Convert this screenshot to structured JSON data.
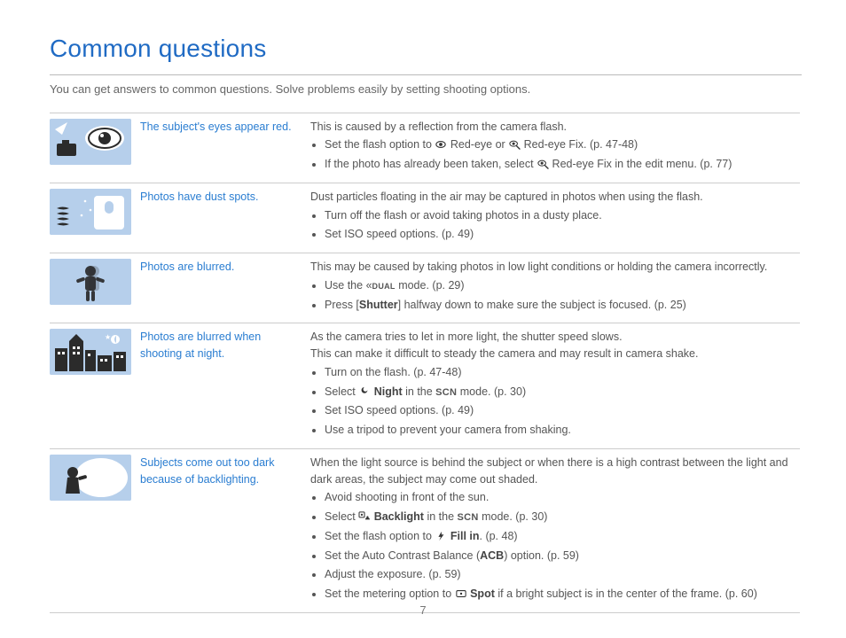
{
  "title": "Common questions",
  "intro": "You can get answers to common questions. Solve problems easily by setting shooting options.",
  "pageNumber": "7",
  "rows": [
    {
      "question": "The subject's eyes appear red.",
      "lead": "This is caused by a reflection from the camera flash.",
      "bullets": [
        {
          "pre": "Set the flash option to ",
          "icon": "eye-icon",
          "mid": " Red-eye or ",
          "icon2": "eye-brush-icon",
          "post": " Red-eye Fix. (p. 47-48)"
        },
        {
          "pre": "If the photo has already been taken, select ",
          "icon": "eye-brush-icon",
          "post": " Red-eye Fix in the edit menu. (p. 77)"
        }
      ]
    },
    {
      "question": "Photos have dust spots.",
      "lead": "Dust particles floating in the air may be captured in photos when using the flash.",
      "bullets": [
        {
          "text": "Turn off the flash or avoid taking photos in a dusty place."
        },
        {
          "text": "Set ISO speed options. (p. 49)"
        }
      ]
    },
    {
      "question": "Photos are blurred.",
      "lead": "This may be caused by taking photos in low light conditions or holding the camera incorrectly.",
      "bullets": [
        {
          "pre": "Use the ",
          "dual": true,
          "post": " mode. (p. 29)"
        },
        {
          "pre": "Press [",
          "bold": "Shutter",
          "post": "] halfway down to make sure the subject is focused. (p. 25)"
        }
      ]
    },
    {
      "question": "Photos are blurred when shooting at night.",
      "lead": "As the camera tries to let in more light, the shutter speed slows.",
      "lead2": "This can make it difficult to steady the camera and may result in camera shake.",
      "bullets": [
        {
          "text": "Turn on the flash. (p. 47-48)"
        },
        {
          "pre": "Select ",
          "icon": "moon-icon",
          "bold": " Night",
          "mid": " in the ",
          "scn": true,
          "post": " mode. (p. 30)"
        },
        {
          "text": "Set ISO speed options. (p. 49)"
        },
        {
          "text": "Use a tripod to prevent your camera from shaking."
        }
      ]
    },
    {
      "question": "Subjects come out too dark because of backlighting.",
      "lead": "When the light source is behind the subject or when there is a high contrast between the light and dark areas, the subject may come out shaded.",
      "bullets": [
        {
          "text": "Avoid shooting in front of the sun."
        },
        {
          "pre": "Select ",
          "icon": "backlight-icon",
          "bold": " Backlight",
          "mid": " in the ",
          "scn": true,
          "post": " mode. (p. 30)"
        },
        {
          "pre": "Set the flash option to ",
          "icon": "flash-icon",
          "bold": " Fill in",
          "post": ". (p. 48)"
        },
        {
          "pre": "Set the Auto Contrast Balance (",
          "bold": "ACB",
          "post": ") option. (p. 59)"
        },
        {
          "text": "Adjust the exposure. (p. 59)"
        },
        {
          "pre": "Set the metering option to ",
          "icon": "spot-icon",
          "bold": " Spot",
          "post": " if a bright subject is in the center of the frame. (p. 60)"
        }
      ]
    }
  ]
}
